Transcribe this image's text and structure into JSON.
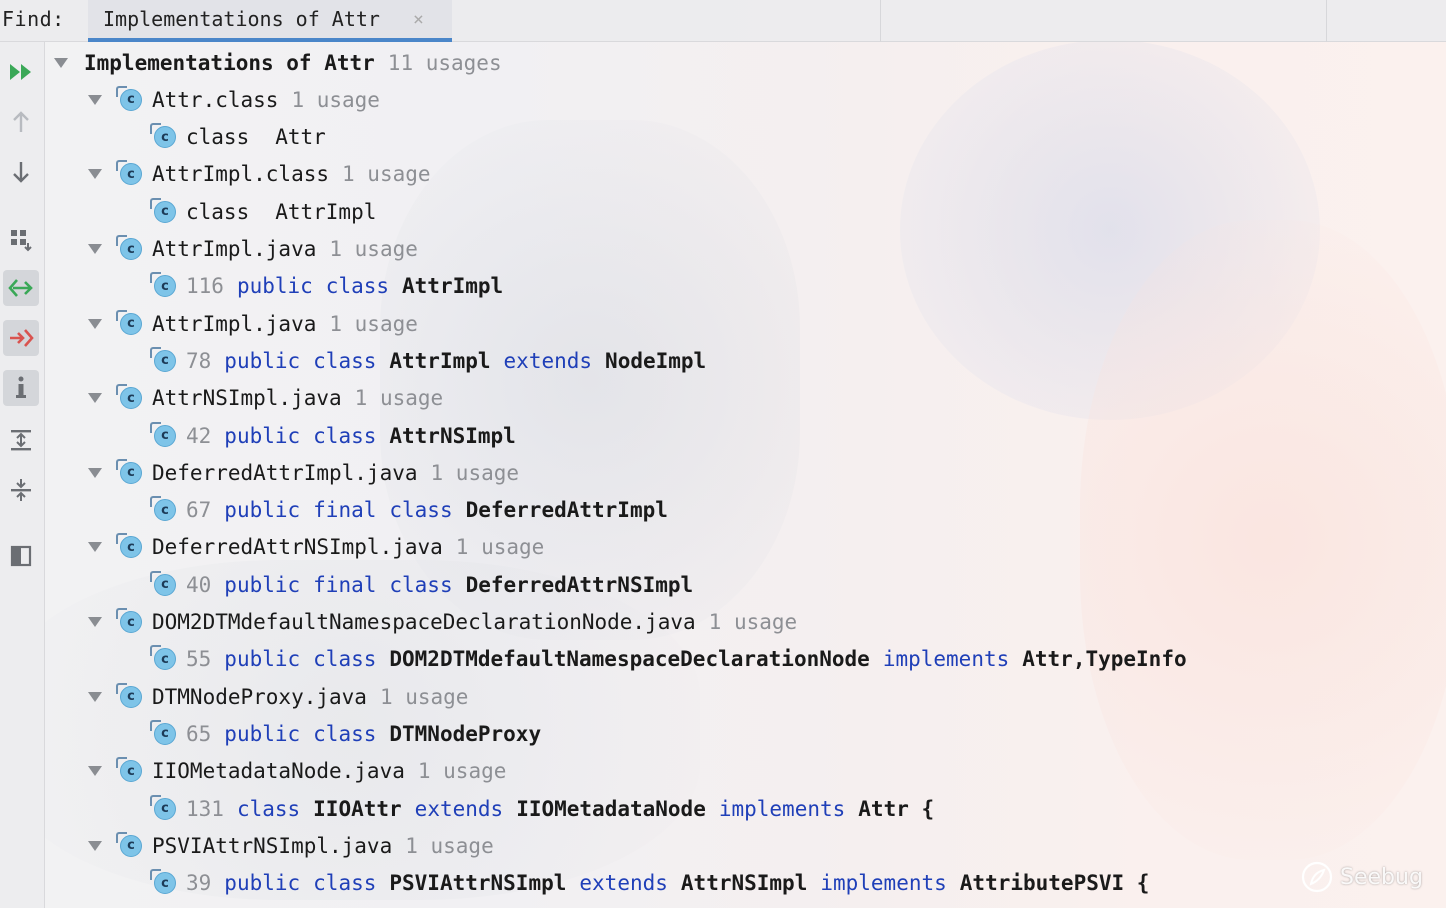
{
  "topbar": {
    "find_label": "Find:",
    "tab_label": "Implementations of Attr",
    "tab_close": "×"
  },
  "root": {
    "label": "Implementations of Attr",
    "count": "11 usages"
  },
  "groups": [
    {
      "file": "Attr.class",
      "count": "1 usage",
      "code": [
        {
          "t": "plain",
          "v": "class"
        },
        {
          "t": "gap2",
          "v": ""
        },
        {
          "t": "plain",
          "v": "Attr"
        }
      ]
    },
    {
      "file": "AttrImpl.class",
      "count": "1 usage",
      "code": [
        {
          "t": "plain",
          "v": "class"
        },
        {
          "t": "gap2",
          "v": ""
        },
        {
          "t": "plain",
          "v": "AttrImpl"
        }
      ]
    },
    {
      "file": "AttrImpl.java",
      "count": "1 usage",
      "code": [
        {
          "t": "line",
          "v": "116"
        },
        {
          "t": "kw",
          "v": "public"
        },
        {
          "t": "kw",
          "v": "class"
        },
        {
          "t": "bold",
          "v": "AttrImpl"
        }
      ]
    },
    {
      "file": "AttrImpl.java",
      "count": "1 usage",
      "code": [
        {
          "t": "line",
          "v": "78"
        },
        {
          "t": "kw",
          "v": "public"
        },
        {
          "t": "kw",
          "v": "class"
        },
        {
          "t": "bold",
          "v": "AttrImpl"
        },
        {
          "t": "kw",
          "v": "extends"
        },
        {
          "t": "bold",
          "v": "NodeImpl"
        }
      ]
    },
    {
      "file": "AttrNSImpl.java",
      "count": "1 usage",
      "code": [
        {
          "t": "line",
          "v": "42"
        },
        {
          "t": "kw",
          "v": "public"
        },
        {
          "t": "kw",
          "v": "class"
        },
        {
          "t": "bold",
          "v": "AttrNSImpl"
        }
      ]
    },
    {
      "file": "DeferredAttrImpl.java",
      "count": "1 usage",
      "code": [
        {
          "t": "line",
          "v": "67"
        },
        {
          "t": "kw",
          "v": "public"
        },
        {
          "t": "kw",
          "v": "final"
        },
        {
          "t": "kw",
          "v": "class"
        },
        {
          "t": "bold",
          "v": "DeferredAttrImpl"
        }
      ]
    },
    {
      "file": "DeferredAttrNSImpl.java",
      "count": "1 usage",
      "code": [
        {
          "t": "line",
          "v": "40"
        },
        {
          "t": "kw",
          "v": "public"
        },
        {
          "t": "kw",
          "v": "final"
        },
        {
          "t": "kw",
          "v": "class"
        },
        {
          "t": "bold",
          "v": "DeferredAttrNSImpl"
        }
      ]
    },
    {
      "file": "DOM2DTMdefaultNamespaceDeclarationNode.java",
      "count": "1 usage",
      "code": [
        {
          "t": "line",
          "v": "55"
        },
        {
          "t": "kw",
          "v": "public"
        },
        {
          "t": "kw",
          "v": "class"
        },
        {
          "t": "bold",
          "v": "DOM2DTMdefaultNamespaceDeclarationNode"
        },
        {
          "t": "kw",
          "v": "implements"
        },
        {
          "t": "bold",
          "v": "Attr,TypeInfo"
        }
      ]
    },
    {
      "file": "DTMNodeProxy.java",
      "count": "1 usage",
      "code": [
        {
          "t": "line",
          "v": "65"
        },
        {
          "t": "kw",
          "v": "public"
        },
        {
          "t": "kw",
          "v": "class"
        },
        {
          "t": "bold",
          "v": "DTMNodeProxy"
        }
      ]
    },
    {
      "file": "IIOMetadataNode.java",
      "count": "1 usage",
      "code": [
        {
          "t": "line",
          "v": "131"
        },
        {
          "t": "kw",
          "v": "class"
        },
        {
          "t": "bold",
          "v": "IIOAttr"
        },
        {
          "t": "kw",
          "v": "extends"
        },
        {
          "t": "bold",
          "v": "IIOMetadataNode"
        },
        {
          "t": "kw",
          "v": "implements"
        },
        {
          "t": "bold",
          "v": "Attr {"
        }
      ]
    },
    {
      "file": "PSVIAttrNSImpl.java",
      "count": "1 usage",
      "code": [
        {
          "t": "line",
          "v": "39"
        },
        {
          "t": "kw",
          "v": "public"
        },
        {
          "t": "kw",
          "v": "class"
        },
        {
          "t": "bold",
          "v": "PSVIAttrNSImpl"
        },
        {
          "t": "kw",
          "v": "extends"
        },
        {
          "t": "bold",
          "v": "AttrNSImpl"
        },
        {
          "t": "kw",
          "v": "implements"
        },
        {
          "t": "bold",
          "v": "AttributePSVI {"
        }
      ]
    }
  ],
  "class_icon_letter": "c",
  "watermark": {
    "text": "Seebug"
  },
  "colors": {
    "keyword": "#1f3fb8",
    "muted": "#8d8f94",
    "class_icon": "#7ec4e8",
    "tab_underline": "#4a86c9",
    "run_icon": "#3aa857"
  },
  "toolbar_icons": [
    "rerun-icon",
    "previous-occurrence-icon",
    "next-occurrence-icon",
    "group-by-icon",
    "navigate-with-single-click-icon",
    "autoscroll-to-source-icon",
    "info-icon",
    "expand-all-icon",
    "collapse-all-icon",
    "preview-panel-icon"
  ]
}
